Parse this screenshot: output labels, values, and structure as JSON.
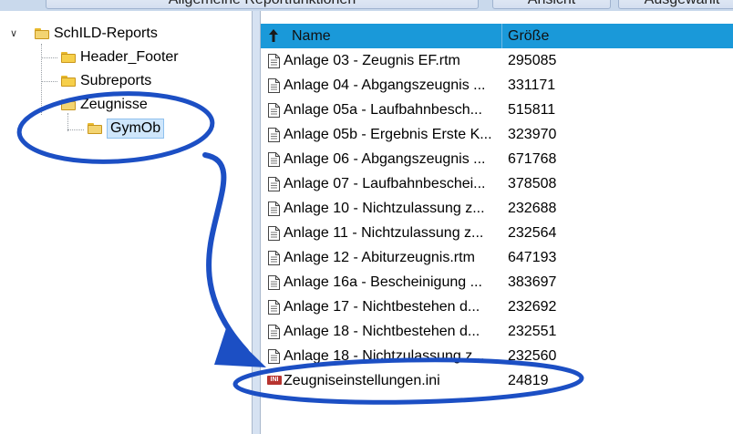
{
  "tabs": [
    {
      "label": "Allgemeine Reportfunktionen"
    },
    {
      "label": "Ansicht"
    },
    {
      "label": "Ausgewählt"
    }
  ],
  "tree": {
    "root": "SchILD-Reports",
    "children": [
      "Header_Footer",
      "Subreports",
      "Zeugnisse"
    ],
    "selected_child": "GymOb"
  },
  "list": {
    "columns": {
      "name": "Name",
      "size": "Größe"
    },
    "rows": [
      {
        "name": "Anlage 03 - Zeugnis EF.rtm",
        "size": "295085"
      },
      {
        "name": "Anlage 04 - Abgangszeugnis ...",
        "size": "331171"
      },
      {
        "name": "Anlage 05a - Laufbahnbesch...",
        "size": "515811"
      },
      {
        "name": "Anlage 05b - Ergebnis Erste K...",
        "size": "323970"
      },
      {
        "name": "Anlage 06 - Abgangszeugnis ...",
        "size": "671768"
      },
      {
        "name": "Anlage 07 - Laufbahnbeschei...",
        "size": "378508"
      },
      {
        "name": "Anlage 10 - Nichtzulassung z...",
        "size": "232688"
      },
      {
        "name": "Anlage 11 - Nichtzulassung z...",
        "size": "232564"
      },
      {
        "name": "Anlage 12 - Abiturzeugnis.rtm",
        "size": "647193"
      },
      {
        "name": "Anlage 16a - Bescheinigung ...",
        "size": "383697"
      },
      {
        "name": "Anlage 17 - Nichtbestehen d...",
        "size": "232692"
      },
      {
        "name": "Anlage 18 - Nichtbestehen d...",
        "size": "232551"
      },
      {
        "name": "Anlage 18 - Nichtzulassung z...",
        "size": "232560"
      },
      {
        "name": "Zeugniseinstellungen.ini",
        "size": "24819",
        "icon": "ini-file-icon"
      }
    ]
  },
  "colors": {
    "header": "#1a99d9",
    "annotation": "#1c4fc4"
  }
}
